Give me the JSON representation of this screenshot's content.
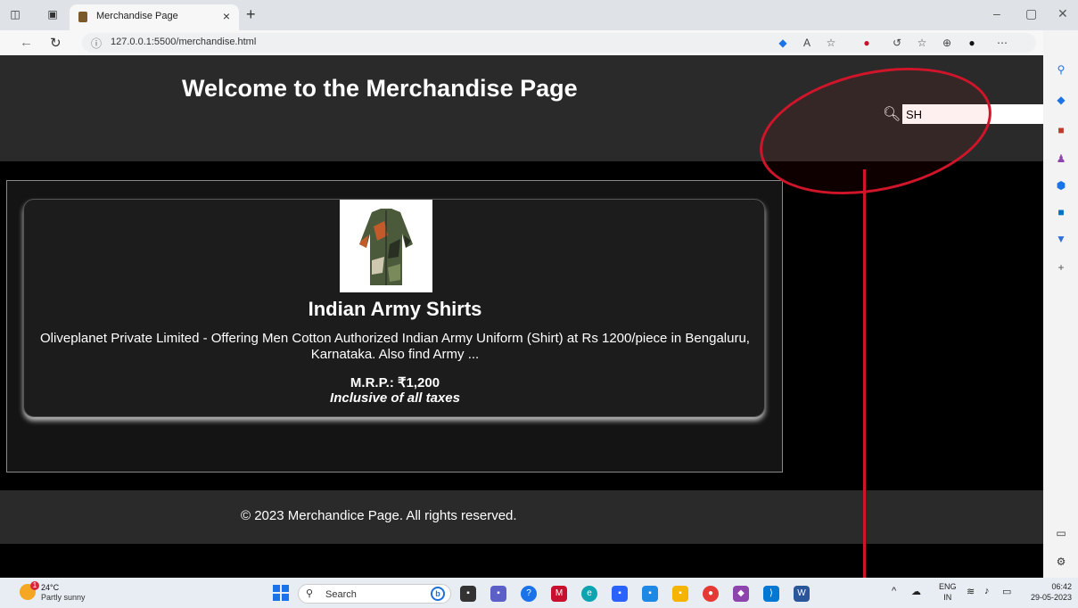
{
  "browser": {
    "tab_title": "Merchandise Page",
    "tab_close": "×",
    "new_tab": "+",
    "url": "127.0.0.1:5500/merchandise.html",
    "win_minimize": "–",
    "win_restore": "▢",
    "win_close": "✕",
    "bing_label": "b"
  },
  "page": {
    "title": "Welcome to the Merchandise Page",
    "search_value": "SH",
    "product": {
      "name": "Indian Army Shirts",
      "description": "Oliveplanet Private Limited - Offering Men Cotton Authorized Indian Army Uniform (Shirt) at Rs 1200/piece in Bengaluru, Karnataka. Also find Army ...",
      "price": "M.R.P.: ₹1,200",
      "tax_note": "Inclusive of all taxes"
    },
    "footer": "© 2023 Merchandice Page. All rights reserved."
  },
  "taskbar": {
    "temperature": "24°C",
    "weather": "Partly sunny",
    "weather_badge": "1",
    "search_label": "Search",
    "lang_top": "ENG",
    "lang_bottom": "IN",
    "time": "06:42",
    "date": "29-05-2023"
  },
  "colors": {
    "annotation": "#d0152a",
    "header_bg": "#2a2a2a"
  }
}
